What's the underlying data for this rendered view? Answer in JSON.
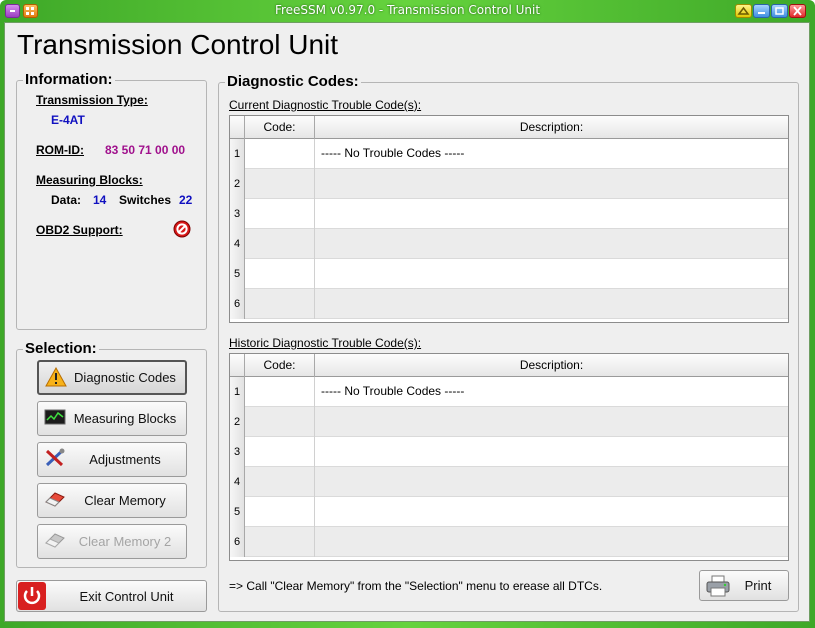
{
  "window": {
    "title": "FreeSSM v0.97.0 - Transmission Control Unit"
  },
  "page_title": "Transmission Control Unit",
  "information": {
    "title": "Information:",
    "transmission_type_label": "Transmission Type:",
    "transmission_type_value": "E-4AT",
    "rom_id_label": "ROM-ID:",
    "rom_id_value": "83 50 71 00 00",
    "measuring_blocks_label": "Measuring Blocks:",
    "data_label": "Data:",
    "data_value": "14",
    "switches_label": "Switches",
    "switches_value": "22",
    "obd2_label": "OBD2 Support:",
    "obd2_icon": "not-supported-icon"
  },
  "selection": {
    "title": "Selection:",
    "buttons": [
      {
        "label": "Diagnostic Codes",
        "icon": "warning-icon",
        "active": true
      },
      {
        "label": "Measuring Blocks",
        "icon": "monitor-chart-icon"
      },
      {
        "label": "Adjustments",
        "icon": "tools-icon"
      },
      {
        "label": "Clear Memory",
        "icon": "eraser-icon"
      },
      {
        "label": "Clear Memory 2",
        "icon": "eraser-icon",
        "disabled": true
      }
    ]
  },
  "exit_button": {
    "label": "Exit Control Unit",
    "icon": "power-icon"
  },
  "diagnostic": {
    "title": "Diagnostic Codes:",
    "current_label": "Current Diagnostic Trouble Code(s):",
    "historic_label": "Historic Diagnostic Trouble Code(s):",
    "columns": [
      "Code:",
      "Description:"
    ],
    "current_rows": [
      {
        "num": "1",
        "code": "",
        "desc": "----- No Trouble Codes -----"
      },
      {
        "num": "2",
        "code": "",
        "desc": ""
      },
      {
        "num": "3",
        "code": "",
        "desc": ""
      },
      {
        "num": "4",
        "code": "",
        "desc": ""
      },
      {
        "num": "5",
        "code": "",
        "desc": ""
      },
      {
        "num": "6",
        "code": "",
        "desc": ""
      }
    ],
    "historic_rows": [
      {
        "num": "1",
        "code": "",
        "desc": "----- No Trouble Codes -----"
      },
      {
        "num": "2",
        "code": "",
        "desc": ""
      },
      {
        "num": "3",
        "code": "",
        "desc": ""
      },
      {
        "num": "4",
        "code": "",
        "desc": ""
      },
      {
        "num": "5",
        "code": "",
        "desc": ""
      },
      {
        "num": "6",
        "code": "",
        "desc": ""
      }
    ],
    "note": "=> Call \"Clear Memory\" from the \"Selection\" menu to erease all DTCs.",
    "print_label": "Print",
    "print_icon": "printer-icon"
  },
  "colors": {
    "titlebar": "#4fbf30",
    "value_blue": "#1010c0",
    "value_purple": "#a0108c"
  }
}
